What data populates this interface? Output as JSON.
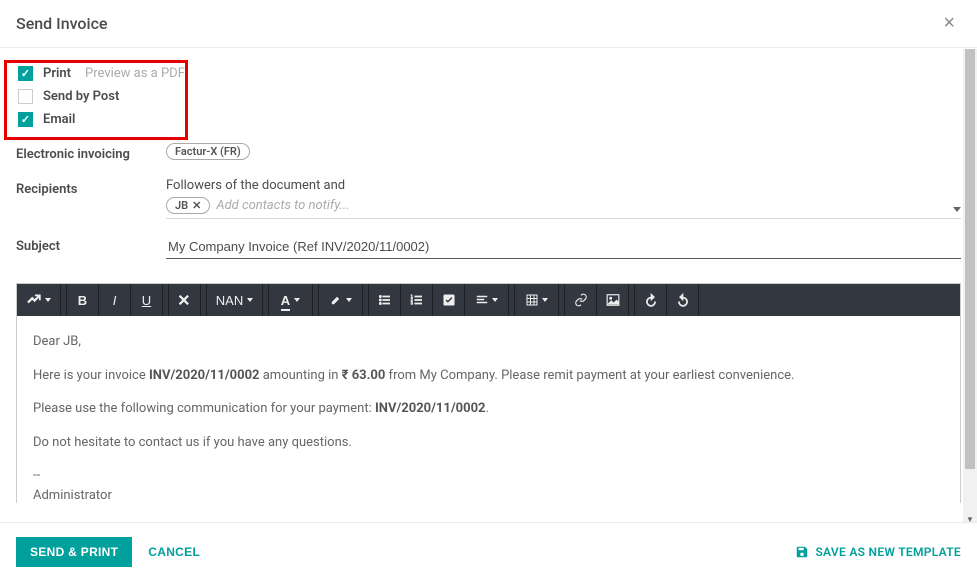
{
  "header": {
    "title": "Send Invoice"
  },
  "options": {
    "print": {
      "label": "Print",
      "hint": "Preview as a PDF",
      "checked": true
    },
    "post": {
      "label": "Send by Post",
      "checked": false
    },
    "email": {
      "label": "Email",
      "checked": true
    }
  },
  "einvoice": {
    "label": "Electronic invoicing",
    "tag": "Factur-X (FR)"
  },
  "recipients": {
    "label": "Recipients",
    "intro": "Followers of the document and",
    "tag": "JB",
    "placeholder": "Add contacts to notify..."
  },
  "subject": {
    "label": "Subject",
    "value": "My Company Invoice (Ref INV/2020/11/0002)"
  },
  "toolbar": {
    "font_size_label": "NAN"
  },
  "body": {
    "greeting": "Dear JB,",
    "line1_a": "Here is your invoice ",
    "line1_inv": "INV/2020/11/0002",
    "line1_b": " amounting in ",
    "line1_amount": "₹ 63.00",
    "line1_c": " from My Company. Please remit payment at your earliest convenience.",
    "line2_a": "Please use the following communication for your payment: ",
    "line2_ref": "INV/2020/11/0002",
    "line2_b": ".",
    "line3": "Do not hesitate to contact us if you have any questions.",
    "sig_dash": "--",
    "sig_name": "Administrator"
  },
  "footer": {
    "send": "SEND & PRINT",
    "cancel": "CANCEL",
    "save_template": "SAVE AS NEW TEMPLATE"
  }
}
